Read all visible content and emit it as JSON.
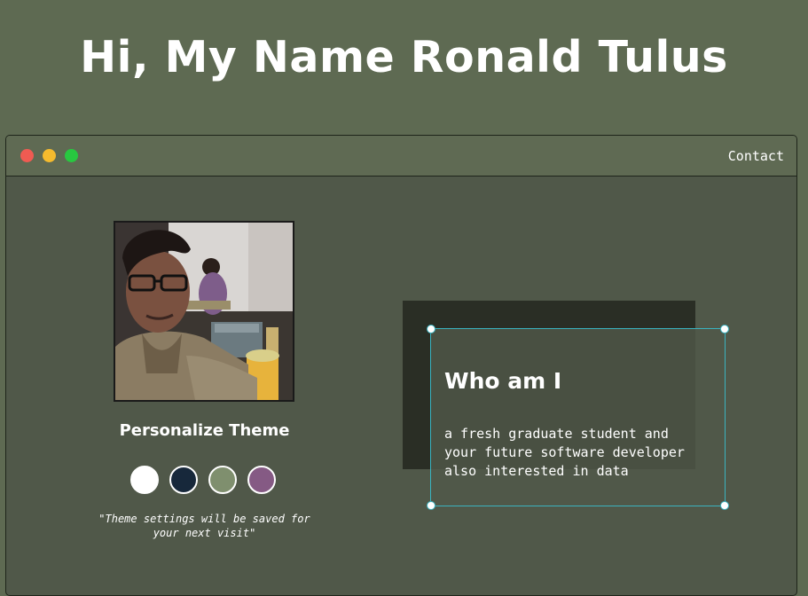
{
  "hero": {
    "title": "Hi, My Name Ronald Tulus"
  },
  "window": {
    "controls": [
      "close",
      "minimize",
      "maximize"
    ],
    "nav": {
      "contact_label": "Contact"
    }
  },
  "profile": {
    "photo_icon": "profile-photo"
  },
  "theme": {
    "title": "Personalize Theme",
    "options": [
      {
        "name": "light",
        "color": "#ffffff"
      },
      {
        "name": "dark-blue",
        "color": "#17283b"
      },
      {
        "name": "green",
        "color": "#7f8f6e"
      },
      {
        "name": "purple",
        "color": "#855a84"
      }
    ],
    "note_line1": "\"Theme settings will be saved for",
    "note_line2": "your next visit\""
  },
  "about": {
    "title": "Who am I",
    "lines": [
      "a fresh graduate student and",
      "your future software developer",
      "also interested in data"
    ]
  },
  "colors": {
    "background": "#5e6a52",
    "window_body": "#505849",
    "accent": "#3ab3c0"
  }
}
